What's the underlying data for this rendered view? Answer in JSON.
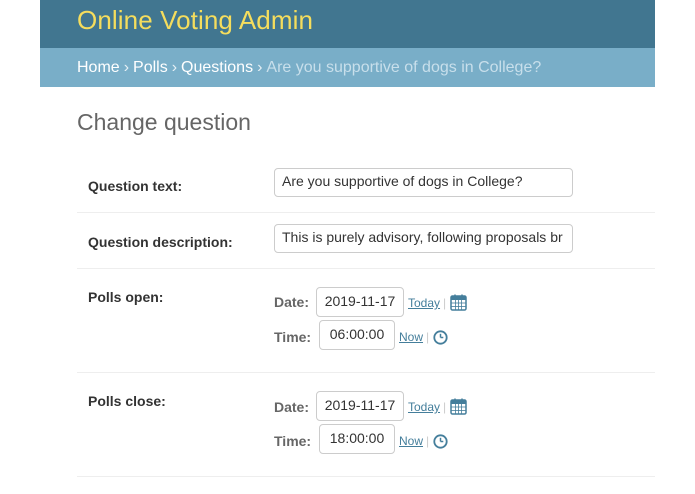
{
  "header": {
    "brand": "Online Voting Admin"
  },
  "breadcrumbs": {
    "items": [
      "Home",
      "Polls",
      "Questions"
    ],
    "current": "Are you supportive of dogs in College?",
    "separator": "›"
  },
  "page": {
    "title": "Change question"
  },
  "form": {
    "question_text": {
      "label": "Question text:",
      "value": "Are you supportive of dogs in College?"
    },
    "question_description": {
      "label": "Question description:",
      "value": "This is purely advisory, following proposals br"
    },
    "polls_open": {
      "label": "Polls open:",
      "date_label": "Date:",
      "date_value": "2019-11-17",
      "today_link": "Today",
      "time_label": "Time:",
      "time_value": "06:00:00",
      "now_link": "Now",
      "pipe": "|"
    },
    "polls_close": {
      "label": "Polls close:",
      "date_label": "Date:",
      "date_value": "2019-11-17",
      "today_link": "Today",
      "time_label": "Time:",
      "time_value": "18:00:00",
      "now_link": "Now",
      "pipe": "|"
    }
  },
  "colors": {
    "header_bg": "#417690",
    "breadcrumbs_bg": "#79aec8",
    "brand_text": "#f5dd5d",
    "link": "#447e9b"
  },
  "icons": {
    "calendar": "calendar-icon",
    "clock": "clock-icon"
  }
}
